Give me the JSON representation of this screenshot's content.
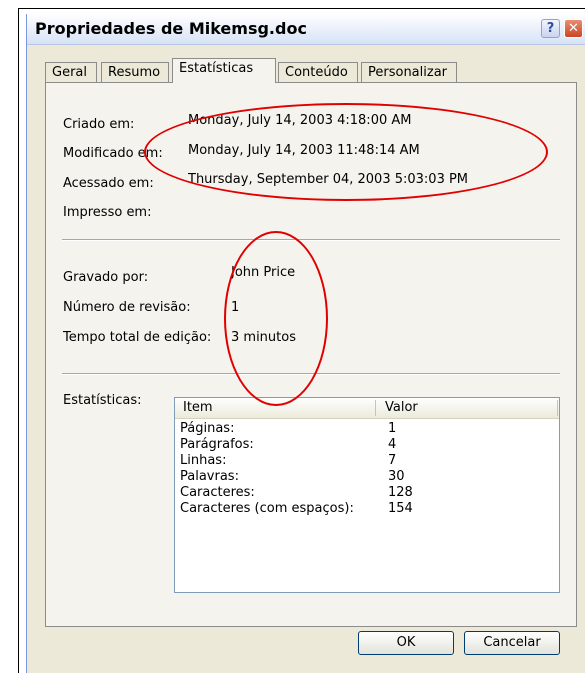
{
  "window": {
    "title": "Propriedades de Mikemsg.doc",
    "help_glyph": "?",
    "close_glyph": "✕"
  },
  "tabs": [
    {
      "label": "Geral"
    },
    {
      "label": "Resumo"
    },
    {
      "label": "Estatísticas",
      "active": true
    },
    {
      "label": "Conteúdo"
    },
    {
      "label": "Personalizar"
    }
  ],
  "dates": {
    "created_label": "Criado em:",
    "created_value": "Monday, July 14, 2003 4:18:00 AM",
    "modified_label": "Modificado em:",
    "modified_value": "Monday, July 14, 2003 11:48:14 AM",
    "accessed_label": "Acessado em:",
    "accessed_value": "Thursday, September 04, 2003 5:03:03 PM",
    "printed_label": "Impresso em:",
    "printed_value": ""
  },
  "info": {
    "saved_by_label": "Gravado por:",
    "saved_by_value": "John Price",
    "revision_label": "Número de revisão:",
    "revision_value": "1",
    "edit_time_label": "Tempo total de edição:",
    "edit_time_value": "3 minutos"
  },
  "statistics": {
    "label": "Estatísticas:",
    "columns": [
      "Item",
      "Valor"
    ],
    "rows": [
      {
        "item": "Páginas:",
        "value": "1"
      },
      {
        "item": "Parágrafos:",
        "value": "4"
      },
      {
        "item": "Linhas:",
        "value": "7"
      },
      {
        "item": "Palavras:",
        "value": "30"
      },
      {
        "item": "Caracteres:",
        "value": "128"
      },
      {
        "item": "Caracteres (com espaços):",
        "value": "154"
      }
    ]
  },
  "buttons": {
    "ok": "OK",
    "cancel": "Cancelar"
  },
  "colors": {
    "annotation": "#e00000",
    "titlebar": "#d6e3f6",
    "close_button": "#c94620"
  }
}
